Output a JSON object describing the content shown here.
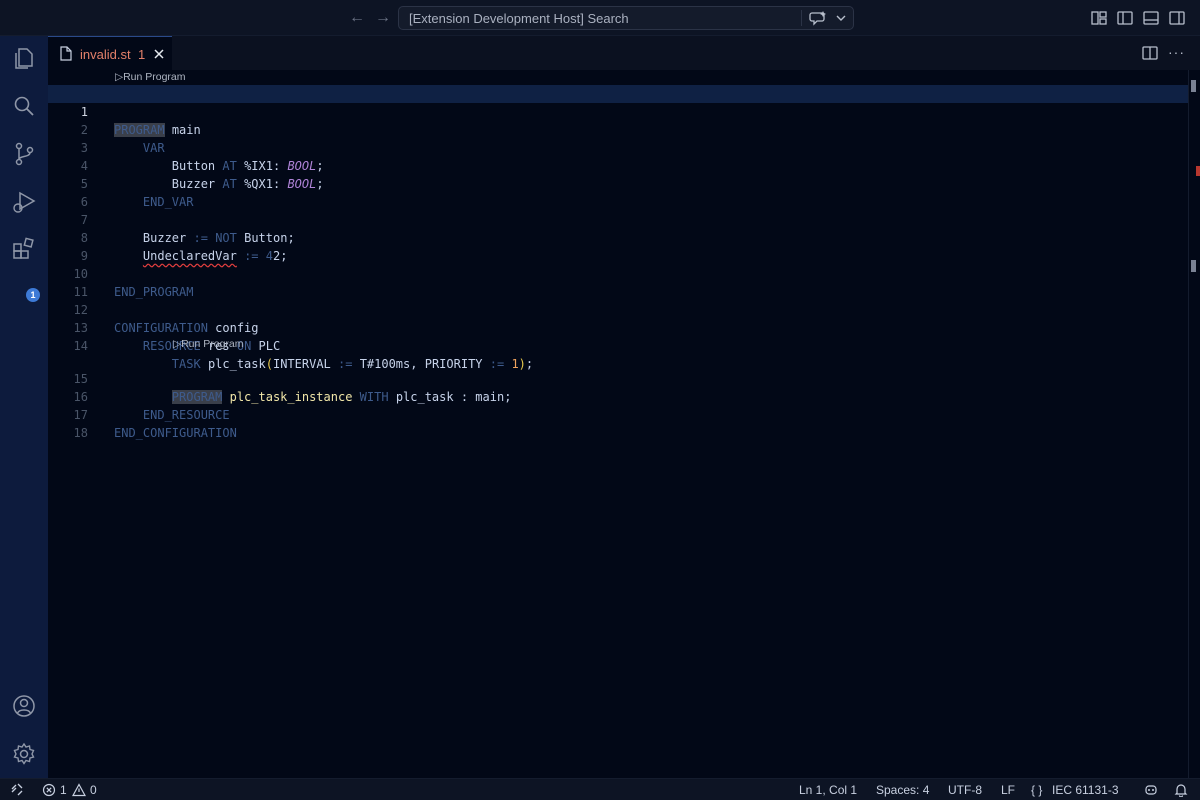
{
  "titlebar": {
    "search_text": "[Extension Development Host] Search",
    "back_glyph": "←",
    "forward_glyph": "→"
  },
  "tabs": [
    {
      "name": "invalid.st",
      "problem_count": "1",
      "close_glyph": "✕"
    }
  ],
  "editor": {
    "codelens_label": "▷Run Program",
    "lines": [
      {
        "n": "1"
      },
      {
        "n": "2"
      },
      {
        "n": "3"
      },
      {
        "n": "4"
      },
      {
        "n": "5"
      },
      {
        "n": "6"
      },
      {
        "n": "7"
      },
      {
        "n": "8"
      },
      {
        "n": "9"
      },
      {
        "n": "10"
      },
      {
        "n": "11"
      },
      {
        "n": "12"
      },
      {
        "n": "13"
      },
      {
        "n": "14"
      },
      {
        "n": "15"
      },
      {
        "n": "16"
      },
      {
        "n": "17"
      },
      {
        "n": "18"
      }
    ],
    "tokens": {
      "program": "PROGRAM",
      "main": "main",
      "var": "VAR",
      "button": "Button",
      "buzzer": "Buzzer",
      "at": "AT",
      "ix1": "%IX1:",
      "qx1": "%QX1:",
      "bool": "BOOL",
      "semi": ";",
      "end_var": "END_VAR",
      "assign": ":=",
      "not": "NOT",
      "button_semi": "Button;",
      "undeclared": "UndeclaredVar",
      "num_4": "4",
      "num_2": "2",
      "end_program": "END_PROGRAM",
      "configuration": "CONFIGURATION",
      "config": "config",
      "resource": "RESOURCE",
      "res": "res",
      "on": "ON",
      "plc": "PLC",
      "task": "TASK",
      "plc_task": "plc_task",
      "lparen": "(",
      "interval": "INTERVAL",
      "t100ms": "T#100ms,",
      "priority": "PRIORITY",
      "num_1": "1",
      "rparen": ")",
      "plc_task_instance": "plc_task_instance",
      "with": "WITH",
      "plc_task_colon": "plc_task :",
      "main_semi": "main;",
      "end_resource": "END_RESOURCE",
      "end_configuration": "END_CONFIGURATION"
    }
  },
  "activitybar": {
    "extensions_badge": "1"
  },
  "statusbar": {
    "errors": "1",
    "warnings": "0",
    "position": "Ln 1, Col 1",
    "spaces": "Spaces: 4",
    "encoding": "UTF-8",
    "eol": "LF",
    "language_braces": "{ }",
    "language": "IEC 61131-3"
  },
  "colors": {
    "keyword": "#3e5b8c",
    "identifier": "#c7d3ea",
    "function": "#f1e6a8",
    "type": "#b084d9",
    "number": "#f0a35e",
    "error": "#e23e3e",
    "tab_label": "#e3806a",
    "activitybar_bg": "#0d1b3d"
  },
  "icons": {
    "activity": [
      "explorer-icon",
      "search-icon",
      "source-control-icon",
      "run-debug-icon",
      "extensions-icon",
      "account-icon",
      "settings-gear-icon"
    ],
    "title": [
      "customize-layout-icon",
      "toggle-primary-sidebar-icon",
      "toggle-panel-icon",
      "toggle-secondary-sidebar-icon"
    ]
  }
}
